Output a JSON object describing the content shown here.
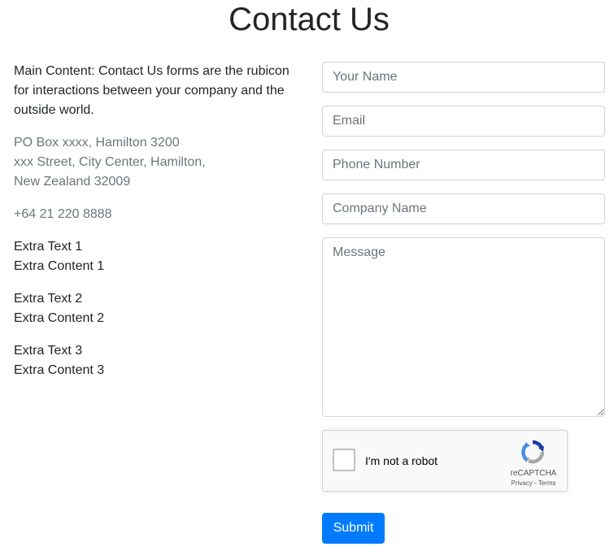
{
  "page": {
    "title": "Contact Us"
  },
  "info": {
    "intro": "Main Content: Contact Us forms are the rubicon for interactions between your company and the outside world.",
    "address": {
      "line1": "PO Box xxxx, Hamilton 3200",
      "line2": "xxx Street, City Center, Hamilton,",
      "line3": "New Zealand 32009"
    },
    "phone": "+64 21 220 8888",
    "extras": [
      {
        "text": "Extra Text 1",
        "content": "Extra Content 1"
      },
      {
        "text": "Extra Text 2",
        "content": "Extra Content 2"
      },
      {
        "text": "Extra Text 3",
        "content": "Extra Content 3"
      }
    ]
  },
  "form": {
    "name": {
      "placeholder": "Your Name",
      "value": ""
    },
    "email": {
      "placeholder": "Email",
      "value": ""
    },
    "phone": {
      "placeholder": "Phone Number",
      "value": ""
    },
    "company": {
      "placeholder": "Company Name",
      "value": ""
    },
    "message": {
      "placeholder": "Message",
      "value": ""
    },
    "submit_label": "Submit"
  },
  "recaptcha": {
    "label": "I'm not a robot",
    "brand": "reCAPTCHA",
    "privacy": "Privacy",
    "separator": " - ",
    "terms": "Terms",
    "checked": false,
    "icon": "recaptcha-logo-icon"
  },
  "colors": {
    "primary": "#007bff",
    "muted": "#6c757d",
    "text": "#212529"
  }
}
